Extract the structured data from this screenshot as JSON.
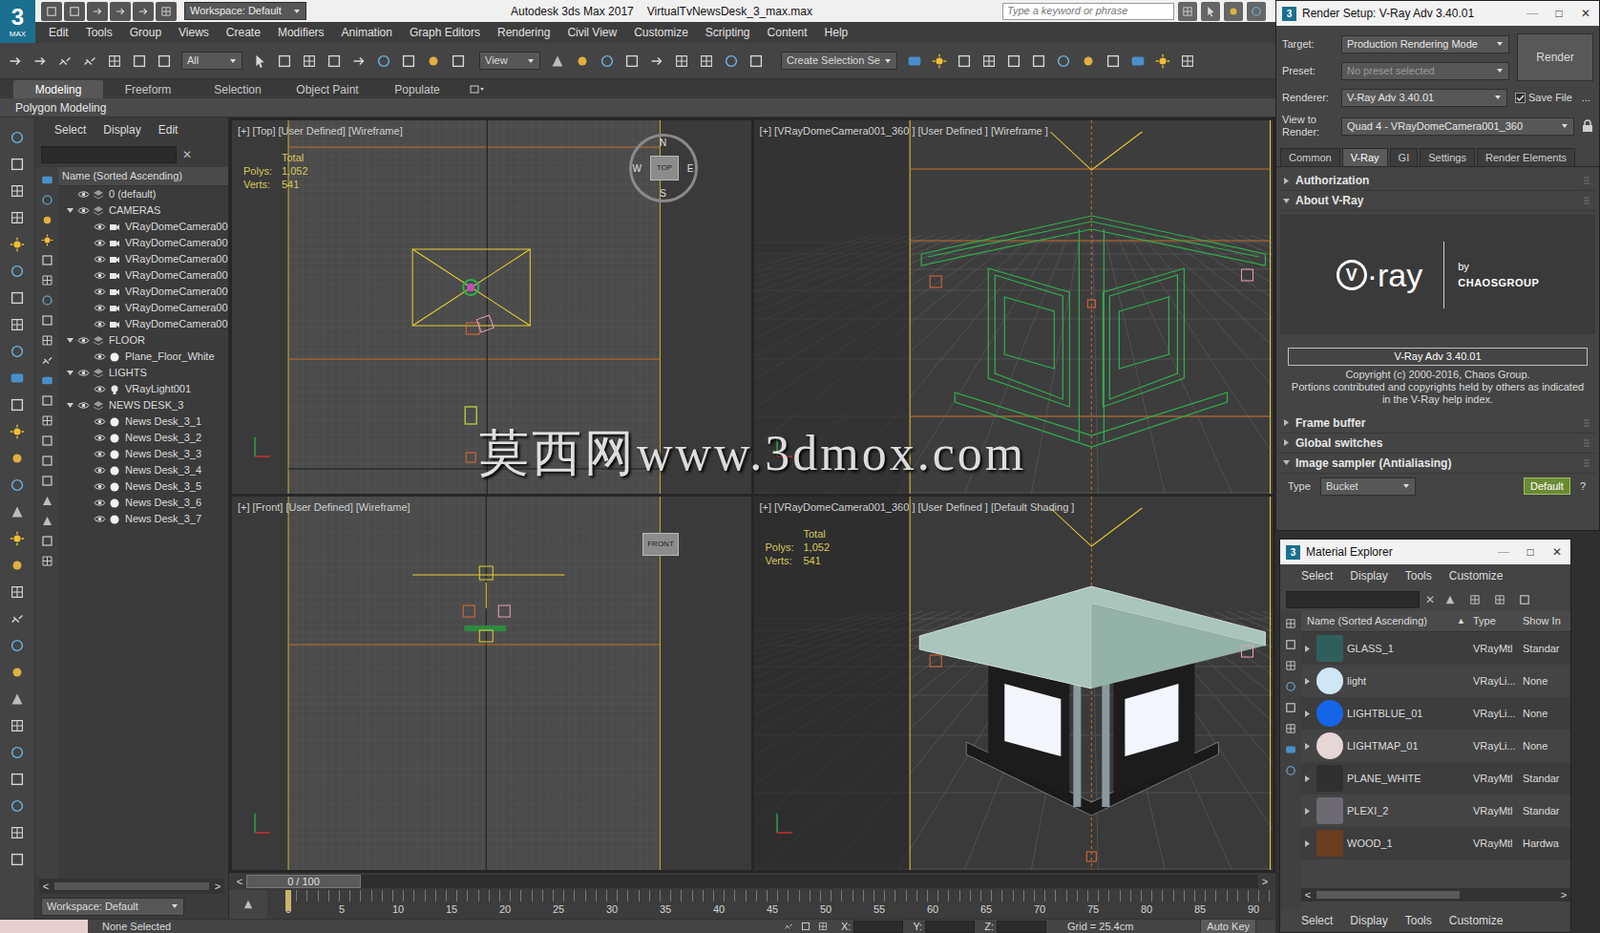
{
  "window": {
    "logo": "3",
    "logo_sub": "MAX",
    "workspace": "Workspace: Default",
    "title": "Autodesk 3ds Max 2017",
    "file": "VirtualTvNewsDesk_3_max.max",
    "search_placeholder": "Type a keyword or phrase"
  },
  "menu": [
    "Edit",
    "Tools",
    "Group",
    "Views",
    "Create",
    "Modifiers",
    "Animation",
    "Graph Editors",
    "Rendering",
    "Civil View",
    "Customize",
    "Scripting",
    "Content",
    "Help"
  ],
  "toolbar": {
    "selection_filter": "All",
    "reference_coordinate": "View",
    "selection_set": "Create Selection Se"
  },
  "ribbon": {
    "tabs": [
      {
        "label": "Modeling",
        "selected": true
      },
      {
        "label": "Freeform",
        "selected": false
      },
      {
        "label": "Selection",
        "selected": false
      },
      {
        "label": "Object Paint",
        "selected": false
      },
      {
        "label": "Populate",
        "selected": false
      }
    ],
    "panel": "Polygon Modeling"
  },
  "explorer": {
    "menu": [
      "Select",
      "Display",
      "Edit"
    ],
    "clear": "✕",
    "column": "Name (Sorted Ascending)",
    "tree": [
      {
        "label": "0 (default)",
        "level": 0,
        "kind": "layer",
        "expanded": false
      },
      {
        "label": "CAMERAS",
        "level": 0,
        "kind": "layer",
        "expanded": true
      },
      {
        "label": "VRayDomeCamera00",
        "level": 1,
        "kind": "camera",
        "expanded": false
      },
      {
        "label": "VRayDomeCamera00",
        "level": 1,
        "kind": "camera",
        "expanded": false
      },
      {
        "label": "VRayDomeCamera00",
        "level": 1,
        "kind": "camera",
        "expanded": false
      },
      {
        "label": "VRayDomeCamera00",
        "level": 1,
        "kind": "camera",
        "expanded": false
      },
      {
        "label": "VRayDomeCamera00",
        "level": 1,
        "kind": "camera",
        "expanded": false
      },
      {
        "label": "VRayDomeCamera00",
        "level": 1,
        "kind": "camera",
        "expanded": false
      },
      {
        "label": "VRayDomeCamera00",
        "level": 1,
        "kind": "camera",
        "expanded": false
      },
      {
        "label": "FLOOR",
        "level": 0,
        "kind": "layer",
        "expanded": true
      },
      {
        "label": "Plane_Floor_White",
        "level": 1,
        "kind": "object",
        "expanded": false
      },
      {
        "label": "LIGHTS",
        "level": 0,
        "kind": "layer",
        "expanded": true
      },
      {
        "label": "VRayLight001",
        "level": 1,
        "kind": "light",
        "expanded": false
      },
      {
        "label": "NEWS DESK_3",
        "level": 0,
        "kind": "layer",
        "expanded": true
      },
      {
        "label": "News Desk_3_1",
        "level": 1,
        "kind": "object",
        "expanded": false
      },
      {
        "label": "News Desk_3_2",
        "level": 1,
        "kind": "object",
        "expanded": false
      },
      {
        "label": "News Desk_3_3",
        "level": 1,
        "kind": "object",
        "expanded": false
      },
      {
        "label": "News Desk_3_4",
        "level": 1,
        "kind": "object",
        "expanded": false
      },
      {
        "label": "News Desk_3_5",
        "level": 1,
        "kind": "object",
        "expanded": false
      },
      {
        "label": "News Desk_3_6",
        "level": 1,
        "kind": "object",
        "expanded": false
      },
      {
        "label": "News Desk_3_7",
        "level": 1,
        "kind": "object",
        "expanded": false
      }
    ],
    "scroll": [
      "<",
      ">"
    ],
    "workspace": "Workspace: Default"
  },
  "viewports": [
    {
      "label": "[+] [Top] [User Defined] [Wireframe]",
      "kind": "top",
      "stats": {
        "total": "Total",
        "polys_label": "Polys:",
        "polys": "1,052",
        "verts_label": "Verts:",
        "verts": "541"
      },
      "cube": {
        "top": "N",
        "bottom": "S",
        "left": "W",
        "right": "E",
        "face": "TOP"
      }
    },
    {
      "label": "[+] [VRayDomeCamera001_360 ] [User Defined ] [Wireframe ]",
      "kind": "camera_wire"
    },
    {
      "label": "[+] [Front] [User Defined] [Wireframe]",
      "kind": "front",
      "cube": {
        "face": "FRONT"
      }
    },
    {
      "label": "[+] [VRayDomeCamera001_360 ] [User Defined ] [Default Shading ]",
      "kind": "camera_shaded",
      "stats": {
        "total": "Total",
        "polys_label": "Polys:",
        "polys": "1,052",
        "verts_label": "Verts:",
        "verts": "541"
      }
    }
  ],
  "watermark": "莫西网www.3dmox.com",
  "timeline": {
    "frame": "0 / 100",
    "level": 0,
    "prev": "<",
    "next": ">",
    "ticks": [
      "0",
      "5",
      "10",
      "15",
      "20",
      "25",
      "30",
      "35",
      "40",
      "45",
      "50",
      "55",
      "60",
      "65",
      "70",
      "75",
      "80",
      "85",
      "90"
    ]
  },
  "status": {
    "selection": "None Selected",
    "x": "X:",
    "y": "Y:",
    "z": "Z:",
    "grid": "Grid = 25.4cm",
    "auto_key": "Auto Key"
  },
  "render_setup": {
    "icon": "3",
    "title": "Render Setup: V-Ray Adv 3.40.01",
    "controls": [
      "—",
      "□",
      "✕"
    ],
    "fields": [
      {
        "label": "Target:",
        "value": "Production Rendering Mode",
        "disabled": false
      },
      {
        "label": "Preset:",
        "value": "No preset selected",
        "disabled": true
      },
      {
        "label": "Renderer:",
        "value": "V-Ray Adv 3.40.01",
        "disabled": false
      },
      {
        "label": "View to Render:",
        "value": "Quad 4 - VRayDomeCamera001_360",
        "disabled": false
      }
    ],
    "render_button": "Render",
    "save_file": {
      "label": "Save File",
      "checked": true
    },
    "more": "...",
    "tabs": [
      {
        "label": "Common",
        "selected": false
      },
      {
        "label": "V-Ray",
        "selected": true
      },
      {
        "label": "GI",
        "selected": false
      },
      {
        "label": "Settings",
        "selected": false
      },
      {
        "label": "Render Elements",
        "selected": false
      }
    ],
    "rollouts": [
      {
        "title": "Authorization",
        "expanded": false,
        "kind": "plain"
      },
      {
        "title": "About V-Ray",
        "expanded": true,
        "kind": "about"
      },
      {
        "title": "Frame buffer",
        "expanded": false,
        "kind": "plain"
      },
      {
        "title": "Global switches",
        "expanded": false,
        "kind": "plain"
      },
      {
        "title": "Image sampler (Antialiasing)",
        "expanded": true,
        "kind": "sampler"
      }
    ],
    "about": {
      "logo_mark": "V",
      "logo_text": "·ray",
      "by": "by",
      "company": "CHAOSGROUP",
      "version": "V-Ray Adv 3.40.01",
      "copyright": "Copyright (c) 2000-2016, Chaos Group.",
      "portions": "Portions contributed and copyrights held by others as indicated in the V-Ray help index."
    },
    "sampler": {
      "label": "Type",
      "value": "Bucket",
      "default": "Default",
      "help": "?"
    }
  },
  "material_explorer": {
    "icon": "3",
    "title": "Material Explorer",
    "controls": [
      "—",
      "□",
      "✕"
    ],
    "menu": [
      "Select",
      "Display",
      "Tools",
      "Customize"
    ],
    "clear": "✕",
    "columns": [
      "Name (Sorted Ascending)",
      "Type",
      "Show In"
    ],
    "sort": "▲",
    "rows": [
      {
        "name": "GLASS_1",
        "type": "VRayMtl",
        "show": "Standar",
        "color": "#2f5f5c",
        "expanded": false
      },
      {
        "name": "light",
        "type": "VRayLi...",
        "show": "None",
        "color": "#cfe6f5",
        "expanded": false
      },
      {
        "name": "LIGHTBLUE_01",
        "type": "VRayLi...",
        "show": "None",
        "color": "#1565e8",
        "expanded": false
      },
      {
        "name": "LIGHTMAP_01",
        "type": "VRayLi...",
        "show": "None",
        "color": "#e6d6d6",
        "expanded": false
      },
      {
        "name": "PLANE_WHITE",
        "type": "VRayMtl",
        "show": "Standar",
        "color": "#303030",
        "expanded": false
      },
      {
        "name": "PLEXI_2",
        "type": "VRayMtl",
        "show": "Standar",
        "color": "#6d6a72",
        "expanded": false
      },
      {
        "name": "WOOD_1",
        "type": "VRayMtl",
        "show": "Hardwa",
        "color": "#6b3d1e",
        "expanded": false
      }
    ],
    "scroll": [
      "<",
      ">"
    ],
    "bottom_menu": [
      "Select",
      "Display",
      "Tools",
      "Customize"
    ]
  }
}
